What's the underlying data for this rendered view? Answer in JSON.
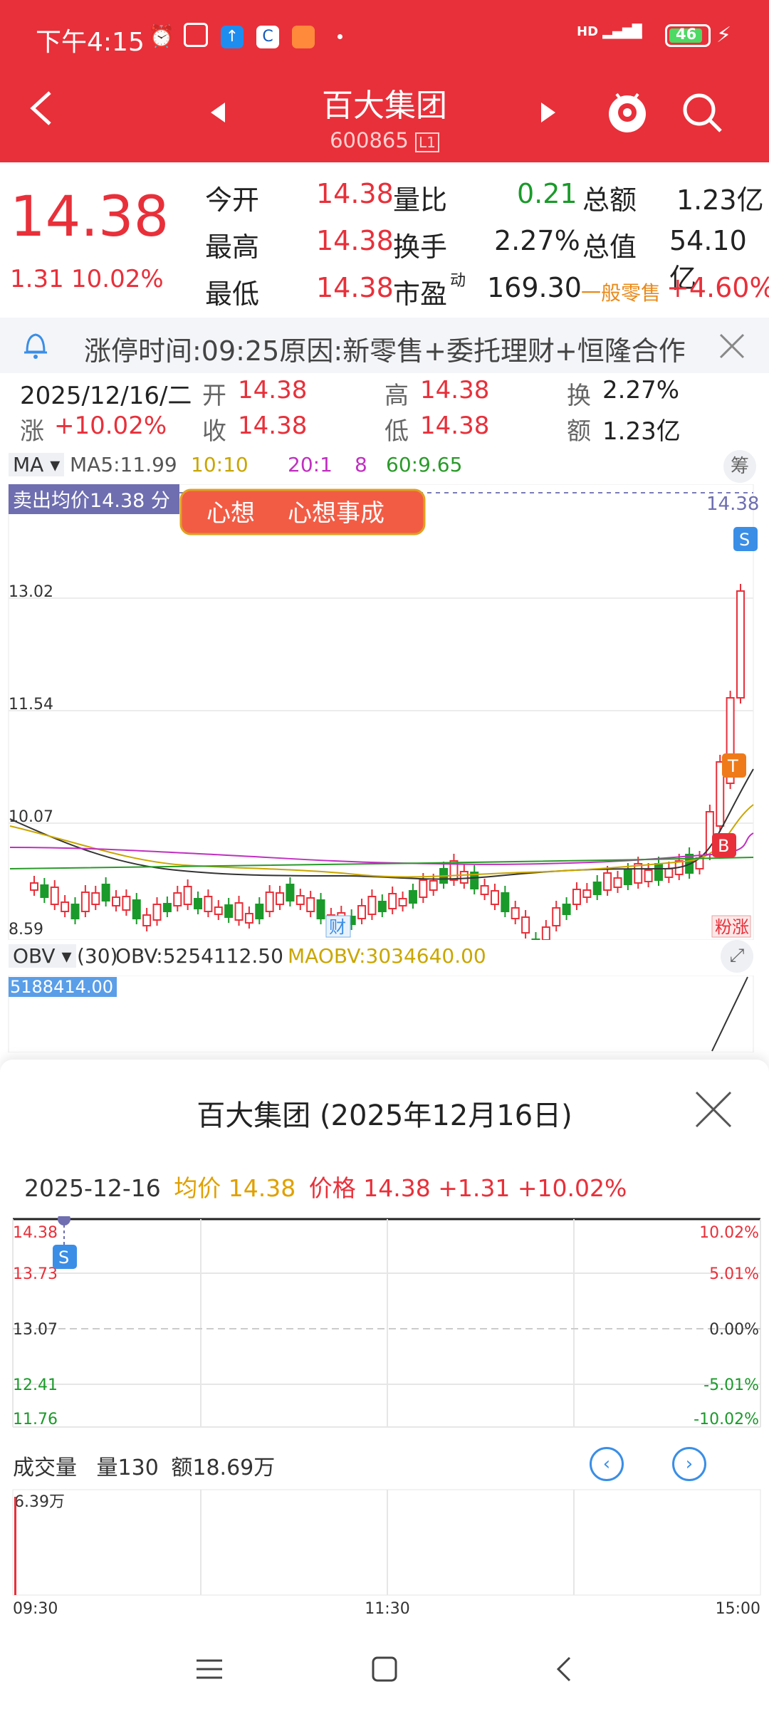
{
  "status_bar": {
    "time": "下午4:15",
    "network": "HD",
    "battery": "46"
  },
  "header": {
    "title": "百大集团",
    "code": "600865",
    "level": "L1"
  },
  "quote": {
    "price": "14.38",
    "change": "1.31",
    "change_pct": "10.02%",
    "open_label": "今开",
    "open": "14.38",
    "high_label": "最高",
    "high": "14.38",
    "low_label": "最低",
    "low": "14.38",
    "vol_ratio_label": "量比",
    "vol_ratio": "0.21",
    "turnover_label": "换手",
    "turnover": "2.27%",
    "pe_label": "市盈",
    "pe_sup": "动",
    "pe": "169.30",
    "amount_label": "总额",
    "amount": "1.23亿",
    "mktcap_label": "总值",
    "mktcap": "54.10亿",
    "sector": "一般零售",
    "sector_pct": "+4.60%"
  },
  "notice": {
    "text": "涨停时间:09:25原因:新零售+委托理财+恒隆合作"
  },
  "kline_header": {
    "date": "2025/12/16/二",
    "open_label": "开",
    "open": "14.38",
    "high_label": "高",
    "high": "14.38",
    "turn_label": "换",
    "turn": "2.27%",
    "chg_label": "涨",
    "chg": "+10.02%",
    "close_label": "收",
    "close": "14.38",
    "low_label": "低",
    "low": "14.38",
    "amt_label": "额",
    "amt": "1.23亿"
  },
  "ma_legend": {
    "ma": "MA",
    "ma5": "MA5:11.99",
    "ma10": "10:10",
    "ma20": "20:1",
    "ma20b": "8",
    "ma60": "60:9.65",
    "chip": "筹"
  },
  "kline": {
    "sell_avg": "卖出均价14.38 分",
    "banner1": "心想",
    "banner2": "心想事成",
    "top_price": "14.38",
    "y_labels": [
      "13.02",
      "11.54",
      "10.07",
      "8.59"
    ],
    "marker_s": "S",
    "marker_t": "T",
    "marker_b": "B",
    "tag_cai": "财",
    "tag_zt": "粉涨"
  },
  "obv": {
    "name": "OBV",
    "period": "(30)",
    "obv": "OBV:5254112.50",
    "maobv": "MAOBV:3034640.00",
    "value_box": "5188414.00"
  },
  "colors": {
    "red": "#e8303a",
    "green": "#1a9a2a",
    "ma5": "#333333",
    "ma10": "#c9a600",
    "ma20": "#c030c0",
    "ma60": "#2a9a2a"
  },
  "sheet": {
    "title": "百大集团 (2025年12月16日)",
    "info_date": "2025-12-16",
    "info_avg_label": "均价",
    "info_avg": "14.38",
    "info_price_label": "价格",
    "info_price": "14.38",
    "info_chg": "+1.31",
    "info_pct": "+10.02%",
    "left_axis": [
      "14.38",
      "13.73",
      "13.07",
      "12.41",
      "11.76"
    ],
    "right_axis": [
      "10.02%",
      "5.01%",
      "0.00%",
      "-5.01%",
      "-10.02%"
    ],
    "marker_s": "S",
    "vol_label": "成交量",
    "vol": "量130",
    "amt": "额18.69万",
    "vol_max": "6.39万",
    "time_axis": [
      "09:30",
      "11:30",
      "15:00"
    ]
  }
}
